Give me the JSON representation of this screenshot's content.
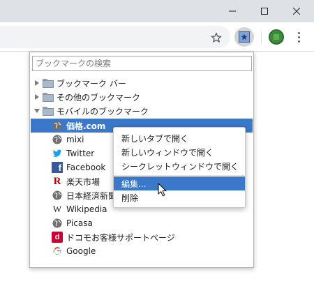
{
  "window": {
    "minimize_icon": "minimize-icon",
    "maximize_icon": "maximize-icon",
    "close_icon": "close-icon"
  },
  "toolbar": {
    "star_icon": "star-icon",
    "extension_icon": "bookmark-manager-extension-icon",
    "profile_color": "#3d8b3d",
    "menu_icon": "vertical-dots-icon"
  },
  "bookmarks": {
    "search_placeholder": "ブックマークの検索",
    "folders": [
      {
        "label": "ブックマーク バー",
        "expanded": false
      },
      {
        "label": "その他のブックマーク",
        "expanded": false
      },
      {
        "label": "モバイルのブックマーク",
        "expanded": true
      }
    ],
    "items": [
      {
        "label": "価格.com",
        "icon": "globe-icon",
        "selected": true
      },
      {
        "label": "mixi",
        "icon": "globe-icon"
      },
      {
        "label": "Twitter",
        "icon": "twitter-icon"
      },
      {
        "label": "Facebook",
        "icon": "facebook-icon"
      },
      {
        "label": "楽天市場",
        "icon": "rakuten-icon"
      },
      {
        "label": "日本経済新聞",
        "icon": "globe-icon"
      },
      {
        "label": "Wikipedia",
        "icon": "wikipedia-icon"
      },
      {
        "label": "Picasa",
        "icon": "globe-icon"
      },
      {
        "label": "ドコモお客様サポートページ",
        "icon": "docomo-icon"
      },
      {
        "label": "Google",
        "icon": "google-icon"
      }
    ]
  },
  "context_menu": {
    "items": [
      "新しいタブで開く",
      "新しいウィンドウで開く",
      "シークレットウィンドウで開く",
      "編集...",
      "削除"
    ],
    "highlighted": "編集..."
  },
  "colors": {
    "selection": "#3b78c9",
    "titlebar": "#dee1e6",
    "twitter": "#1da1f2",
    "facebook": "#3b5998",
    "rakuten": "#bf0000",
    "docomo": "#cc0033"
  }
}
